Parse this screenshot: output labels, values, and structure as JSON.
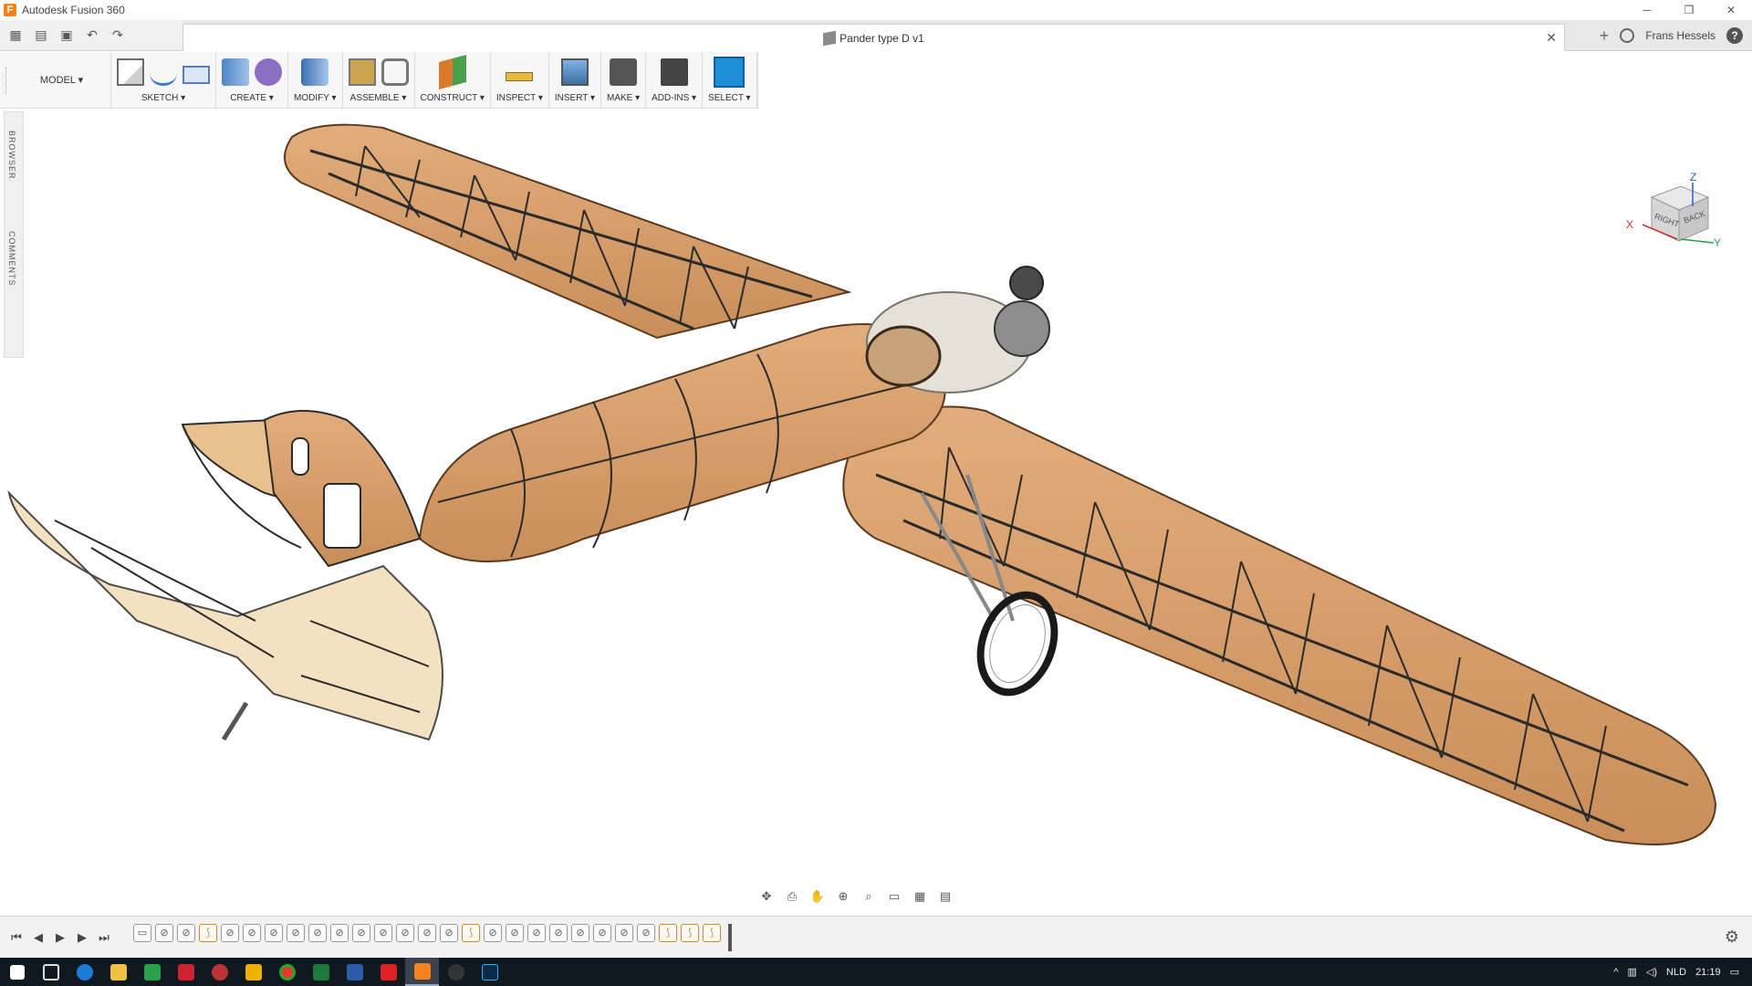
{
  "app": {
    "title": "Autodesk Fusion 360",
    "logo_letter": "F"
  },
  "window_controls": {
    "minimize": "─",
    "restore": "❐",
    "close": "✕"
  },
  "qat": {
    "grid": "▦",
    "file": "▤",
    "save": "▣",
    "undo": "↶",
    "redo": "↷"
  },
  "document": {
    "tab_label": "Pander type D v1",
    "close": "✕"
  },
  "header_right": {
    "new_tab": "+",
    "user": "Frans Hessels",
    "help": "?"
  },
  "workspace": {
    "label": "MODEL ▾"
  },
  "toolbar": {
    "groups": [
      {
        "label": "SKETCH ▾"
      },
      {
        "label": "CREATE ▾"
      },
      {
        "label": "MODIFY ▾"
      },
      {
        "label": "ASSEMBLE ▾"
      },
      {
        "label": "CONSTRUCT ▾"
      },
      {
        "label": "INSPECT ▾"
      },
      {
        "label": "INSERT ▾"
      },
      {
        "label": "MAKE ▾"
      },
      {
        "label": "ADD-INS ▾"
      },
      {
        "label": "SELECT ▾"
      }
    ]
  },
  "side_panel": {
    "browser": "BROWSER",
    "comments": "COMMENTS"
  },
  "viewcube": {
    "face_right": "RIGHT",
    "face_back": "BACK",
    "axis_x": "X",
    "axis_y": "Y",
    "axis_z": "Z"
  },
  "navbar": {
    "orbit": "✥",
    "look": "⎙",
    "pan": "✋",
    "zoom": "⊕",
    "fit": "⌕",
    "display": "▭",
    "grid": "▦",
    "views": "▤"
  },
  "timeline": {
    "first": "⏮",
    "prev": "◀",
    "play": "▶",
    "next": "▶",
    "last": "⏭",
    "settings": "⚙"
  },
  "taskbar": {
    "language": "NLD",
    "time": "21:19"
  },
  "colors": {
    "wood": "#d9a06b",
    "wood_dark": "#b87d4b",
    "frame": "#2b2b2b",
    "accent": "#1e8fd6"
  }
}
